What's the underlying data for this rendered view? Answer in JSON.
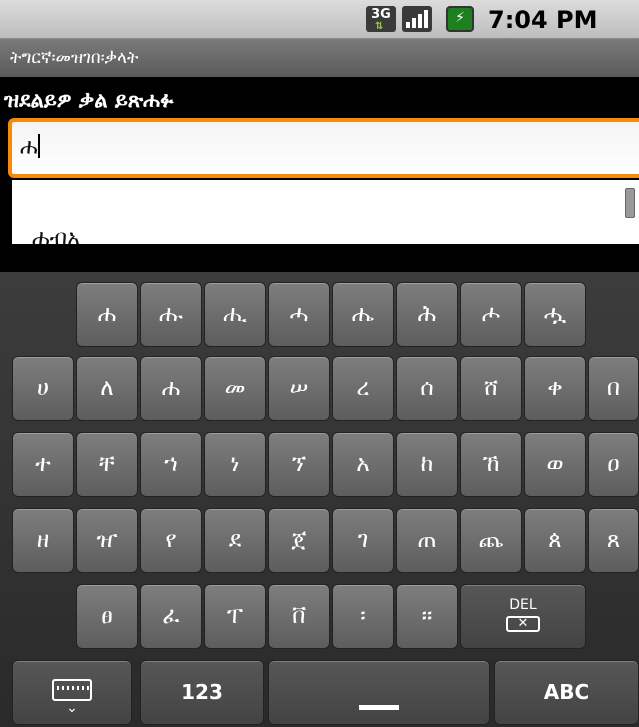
{
  "status_bar": {
    "network": "3G",
    "time": "7:04 PM"
  },
  "app": {
    "title": "ትግርኛ፡መዝገበ፡ቃላት"
  },
  "search": {
    "prompt": "ዝደልይዎ ቃል ይጽሐፉ",
    "value": "ሐ"
  },
  "suggestions": [
    "ሐብአ"
  ],
  "keyboard": {
    "row1": [
      "ሐ",
      "ሑ",
      "ሒ",
      "ሓ",
      "ሔ",
      "ሕ",
      "ሖ",
      "ሗ"
    ],
    "row2": [
      "ሀ",
      "ለ",
      "ሐ",
      "መ",
      "ሠ",
      "ረ",
      "ሰ",
      "ሸ",
      "ቀ",
      "በ"
    ],
    "row3": [
      "ተ",
      "ቸ",
      "ኀ",
      "ነ",
      "ኘ",
      "አ",
      "ከ",
      "ኸ",
      "ወ",
      "ዐ"
    ],
    "row4": [
      "ዘ",
      "ዠ",
      "የ",
      "ደ",
      "ጀ",
      "ገ",
      "ጠ",
      "ጨ",
      "ጰ",
      "ጸ"
    ],
    "row5": [
      "ፀ",
      "ፈ",
      "ፐ",
      "ቨ",
      "፡",
      "።"
    ],
    "del_label": "DEL",
    "numbers_label": "123",
    "abc_label": "ABC"
  }
}
